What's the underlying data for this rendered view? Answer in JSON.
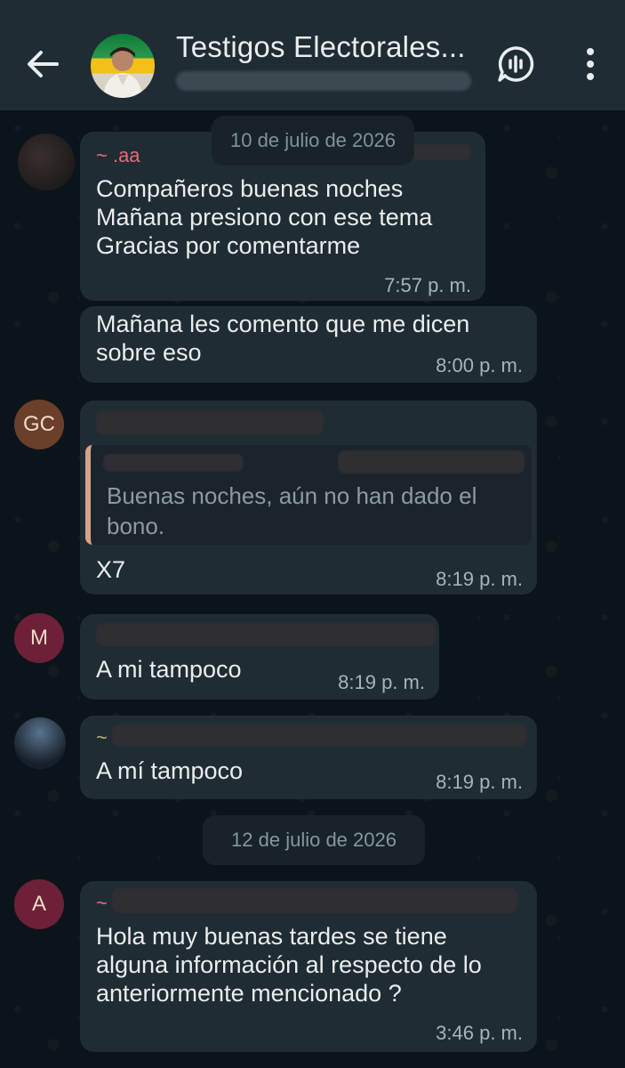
{
  "header": {
    "title": "Testigos Electorales...",
    "avatar_label": "group-photo"
  },
  "date_chips": [
    "10 de julio de 2026",
    "12 de julio de 2026"
  ],
  "messages": [
    {
      "sender": "~ .aa",
      "sender_color": "#e66a7a",
      "text": "Compañeros buenas noches\nMañana presiono con ese tema\nGracias por comentarme",
      "time": "7:57 p. m."
    },
    {
      "text": "Mañana les comento que me dicen\nsobre eso",
      "time": "8:00 p. m."
    },
    {
      "avatar_initials": "GC",
      "avatar_color": "#6b3f2a",
      "quote_text": "Buenas noches, aún no han dado el\nbono.",
      "text": "X7",
      "time": "8:19 p. m."
    },
    {
      "avatar_initials": "M",
      "avatar_color": "#6e2038",
      "text": "A mi tampoco",
      "time": "8:19 p. m."
    },
    {
      "sender": "~",
      "text": "A mí tampoco",
      "time": "8:19 p. m."
    },
    {
      "avatar_initials": "A",
      "avatar_color": "#6e2038",
      "sender": "~",
      "text": "Hola muy buenas tardes se tiene\nalguna información al respecto de lo\nanteriormente mencionado ?",
      "time": "3:46 p. m."
    }
  ],
  "colors": {
    "header_bg": "#1f2c34",
    "bubble_bg": "#202c33",
    "chat_bg": "#0b141a",
    "text": "#e9edef",
    "meta_text": "#a7b3ba"
  }
}
